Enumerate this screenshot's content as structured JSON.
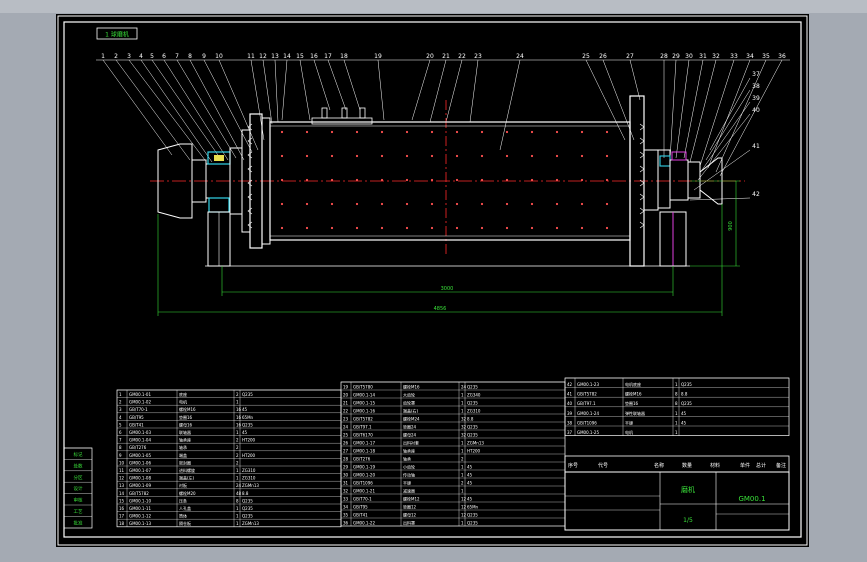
{
  "drawing": {
    "title_tag": "1 球磨机",
    "title_block": {
      "name": "磨机",
      "part": "GM00.1",
      "sub": "1/5",
      "headers": [
        "序号",
        "代号",
        "名称",
        "数量",
        "材料",
        "单件",
        "总计",
        "备注"
      ]
    },
    "dimensions": {
      "width_overall": "4856",
      "length_cylinder": "3000",
      "height": "900"
    },
    "balloons_top": [
      "1",
      "2",
      "3",
      "4",
      "5",
      "6",
      "7",
      "8",
      "9",
      "10",
      "11",
      "12",
      "13",
      "14",
      "15",
      "16",
      "17",
      "18",
      "19",
      "20",
      "21",
      "22",
      "23",
      "24",
      "25",
      "26",
      "27",
      "28",
      "29",
      "30",
      "31",
      "32",
      "33",
      "34",
      "35",
      "36"
    ],
    "balloons_right": [
      "37",
      "38",
      "39",
      "40",
      "41",
      "42"
    ]
  },
  "colors": {
    "paper": "#000000",
    "frame": "#ffffff",
    "outline": "#ffffff",
    "centerline": "#ff2a2a",
    "dimension": "#38e038",
    "cyan_part": "#32d4e8",
    "magenta_part": "#e040e0",
    "yellow_part": "#e8e050"
  },
  "bom_left": [
    [
      "1",
      "GM00.1-01",
      "底座",
      "2",
      "Q235"
    ],
    [
      "2",
      "GM00.1-02",
      "电机",
      "1",
      ""
    ],
    [
      "3",
      "GB/T70-1",
      "螺栓M16",
      "16",
      "45"
    ],
    [
      "4",
      "GB/T95",
      "垫圈16",
      "16",
      "65Mn"
    ],
    [
      "5",
      "GB/T41",
      "螺母16",
      "16",
      "Q235"
    ],
    [
      "6",
      "GM00.1-03",
      "联轴器",
      "1",
      "45"
    ],
    [
      "7",
      "GM00.1-04",
      "轴承座",
      "2",
      "HT200"
    ],
    [
      "8",
      "GB/T276",
      "轴承",
      "2",
      ""
    ],
    [
      "9",
      "GM00.1-05",
      "端盖",
      "2",
      "HT200"
    ],
    [
      "10",
      "GM00.1-06",
      "密封圈",
      "2",
      ""
    ],
    [
      "11",
      "GM00.1-07",
      "进料螺旋",
      "1",
      "ZG310"
    ],
    [
      "12",
      "GM00.1-08",
      "端盖(左)",
      "1",
      "ZG310"
    ],
    [
      "13",
      "GM00.1-09",
      "衬板",
      "24",
      "ZGMn13"
    ],
    [
      "14",
      "GB/T5782",
      "螺栓M20",
      "48",
      "8.8"
    ],
    [
      "15",
      "GM00.1-10",
      "压条",
      "8",
      "Q235"
    ],
    [
      "16",
      "GM00.1-11",
      "人孔盖",
      "1",
      "Q235"
    ],
    [
      "17",
      "GM00.1-12",
      "筒体",
      "1",
      "Q235"
    ],
    [
      "18",
      "GM00.1-13",
      "隔仓板",
      "1",
      "ZGMn13"
    ]
  ],
  "bom_mid": [
    [
      "19",
      "GB/T5780",
      "螺栓M16",
      "24",
      "Q235"
    ],
    [
      "20",
      "GM00.1-14",
      "大齿轮",
      "1",
      "ZG340"
    ],
    [
      "21",
      "GM00.1-15",
      "齿轮罩",
      "1",
      "Q235"
    ],
    [
      "22",
      "GM00.1-16",
      "端盖(右)",
      "1",
      "ZG310"
    ],
    [
      "23",
      "GB/T5782",
      "螺栓M24",
      "32",
      "8.8"
    ],
    [
      "24",
      "GB/T97.1",
      "垫圈24",
      "32",
      "Q235"
    ],
    [
      "25",
      "GB/T6170",
      "螺母24",
      "32",
      "Q235"
    ],
    [
      "26",
      "GM00.1-17",
      "出料衬套",
      "1",
      "ZGMn13"
    ],
    [
      "27",
      "GM00.1-18",
      "轴承座",
      "1",
      "HT200"
    ],
    [
      "28",
      "GB/T276",
      "轴承",
      "2",
      ""
    ],
    [
      "29",
      "GM00.1-19",
      "小齿轮",
      "1",
      "45"
    ],
    [
      "30",
      "GM00.1-20",
      "传动轴",
      "1",
      "45"
    ],
    [
      "31",
      "GB/T1096",
      "平键",
      "2",
      "45"
    ],
    [
      "32",
      "GM00.1-21",
      "减速器",
      "1",
      ""
    ],
    [
      "33",
      "GB/T70-1",
      "螺栓M12",
      "12",
      "45"
    ],
    [
      "34",
      "GB/T95",
      "垫圈12",
      "12",
      "65Mn"
    ],
    [
      "35",
      "GB/T41",
      "螺母12",
      "12",
      "Q235"
    ],
    [
      "36",
      "GM00.1-22",
      "出料罩",
      "1",
      "Q235"
    ]
  ],
  "bom_right": [
    [
      "42",
      "GM00.1-23",
      "电机底座",
      "1",
      "Q235"
    ],
    [
      "41",
      "GB/T5782",
      "螺栓M16",
      "8",
      "8.8"
    ],
    [
      "40",
      "GB/T97.1",
      "垫圈16",
      "8",
      "Q235"
    ],
    [
      "39",
      "GM00.1-24",
      "弹性联轴器",
      "1",
      "45"
    ],
    [
      "38",
      "GB/T1096",
      "平键",
      "1",
      "45"
    ],
    [
      "37",
      "GM00.1-25",
      "电机",
      "1",
      ""
    ]
  ],
  "stamp": [
    "标记",
    "处数",
    "分区",
    "设计",
    "审核",
    "工艺",
    "批准"
  ]
}
